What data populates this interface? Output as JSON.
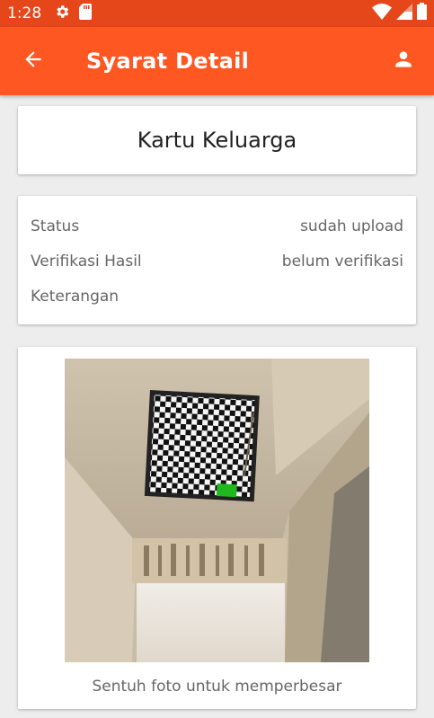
{
  "status_bar": {
    "time": "1:28",
    "icons": [
      "gear-icon",
      "sd-card-icon",
      "wifi-icon",
      "signal-icon",
      "battery-icon"
    ]
  },
  "app_bar": {
    "title": "Syarat Detail",
    "back_icon": "arrow-back-icon",
    "profile_icon": "person-icon",
    "color": "#ff5722"
  },
  "document": {
    "title": "Kartu Keluarga"
  },
  "info": {
    "rows": [
      {
        "label": "Status",
        "value": "sudah upload"
      },
      {
        "label": "Verifikasi Hasil",
        "value": "belum verifikasi"
      },
      {
        "label": "Keterangan",
        "value": ""
      }
    ]
  },
  "photo": {
    "caption": "Sentuh foto untuk memperbesar"
  }
}
